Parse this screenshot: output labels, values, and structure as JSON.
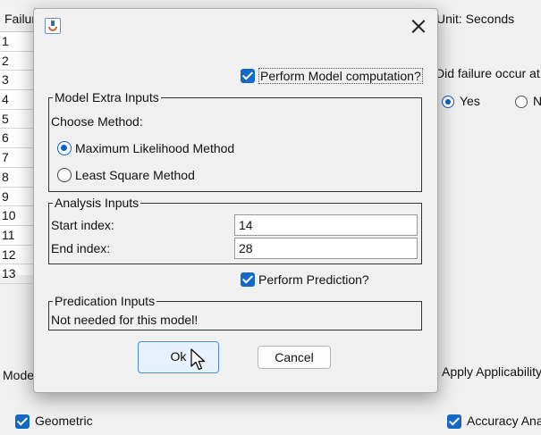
{
  "background": {
    "table": {
      "header": "Failur",
      "rows": [
        "1",
        "2",
        "3",
        "4",
        "5",
        "6",
        "7",
        "8",
        "9",
        "10",
        "11",
        "12",
        "13"
      ]
    },
    "unit_label": "Unit: Seconds",
    "failure_question": "Did failure occur at",
    "yes_label": "Yes",
    "no_label": "N",
    "model_label": "Mode",
    "apply_label": "Apply Applicability",
    "geometric_label": "Geometric",
    "accuracy_label": "Accuracy Ana"
  },
  "dialog": {
    "perform_model_label": "Perform Model computation?",
    "model_extra": {
      "legend": "Model Extra Inputs",
      "choose_label": "Choose Method:",
      "methods": [
        "Maximum Likelihood Method",
        "Least Square Method"
      ],
      "selected": "Maximum Likelihood Method"
    },
    "analysis": {
      "legend": "Analysis Inputs",
      "start_label": "Start index:",
      "start_value": "14",
      "end_label": "End index:",
      "end_value": "28"
    },
    "perform_prediction_label": "Perform Prediction?",
    "prediction": {
      "legend": "Predication Inputs",
      "note": "Not needed for this model!"
    },
    "ok_label": "Ok",
    "cancel_label": "Cancel"
  },
  "colors": {
    "accent": "#1668c4",
    "background": "#f0f0f0"
  }
}
